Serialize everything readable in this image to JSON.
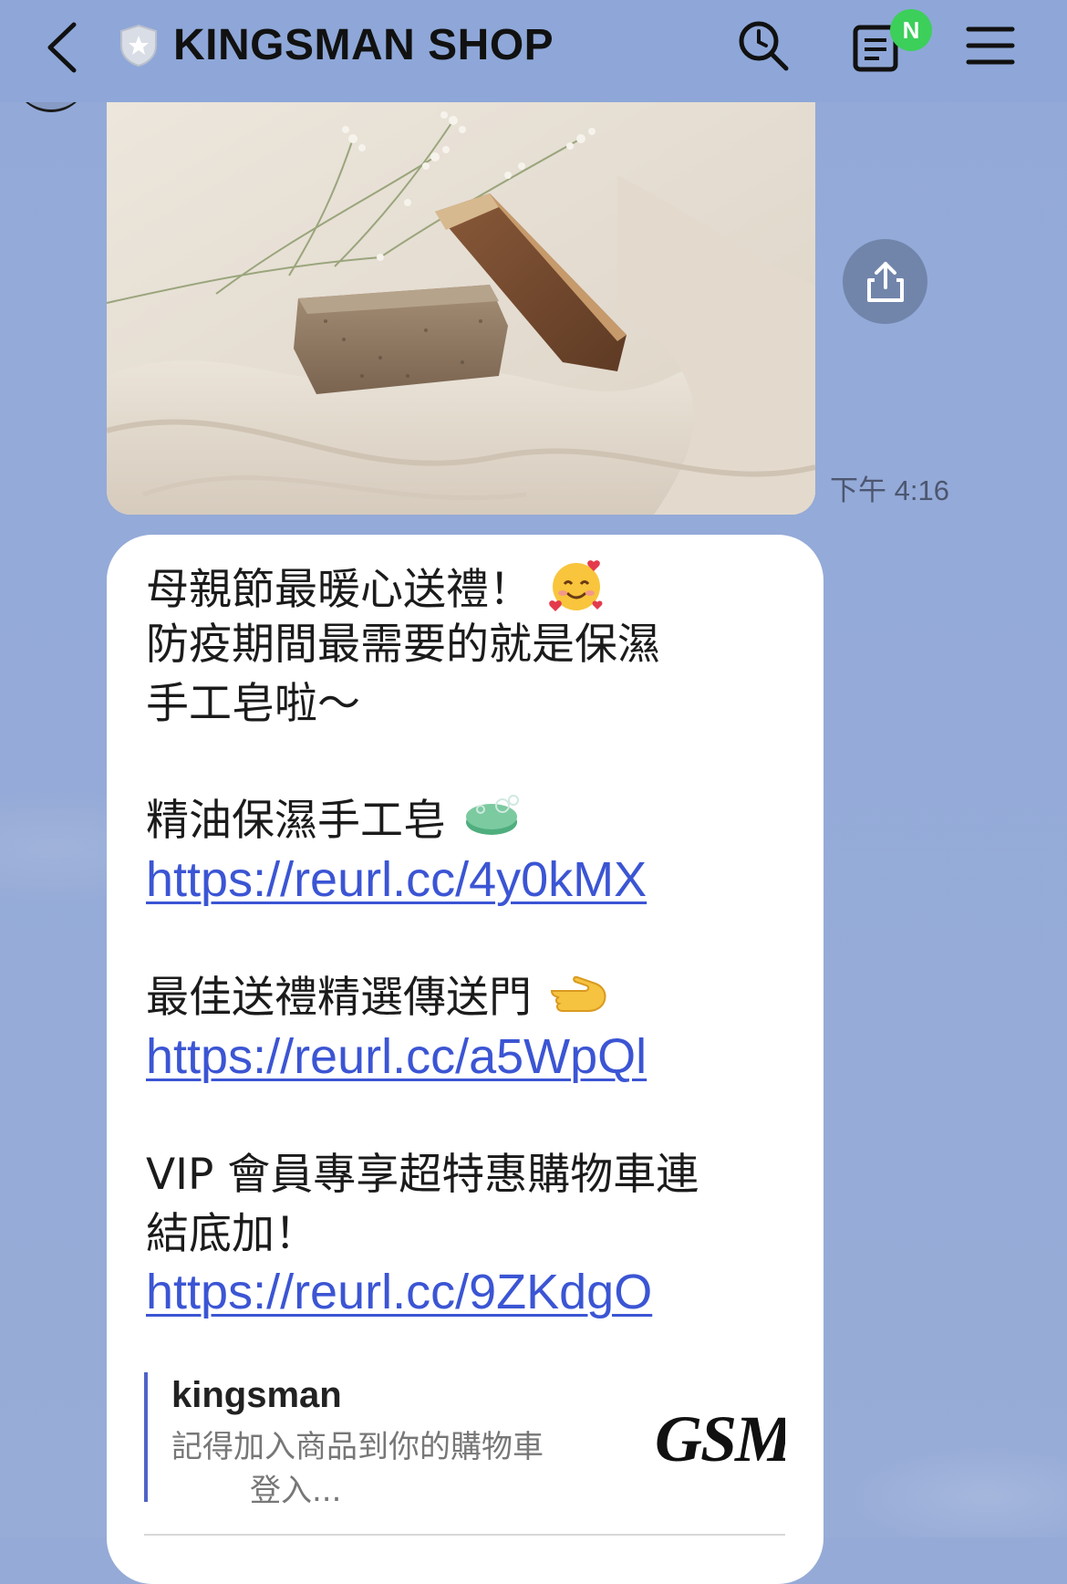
{
  "header": {
    "title": "KINGSMAN SHOP",
    "badge": "N",
    "icons": [
      "back-arrow-icon",
      "shield-star-icon",
      "search-clock-icon",
      "notes-icon",
      "menu-icon"
    ]
  },
  "photo_message": {
    "timestamp": "下午 4:16",
    "share_icon": "share-icon"
  },
  "text_message": {
    "line1": "母親節最暖心送禮！",
    "line2": "防疫期間最需要的就是保濕",
    "line3": "手工皂啦～",
    "product_label": "精油保濕手工皂",
    "product_link": "https://reurl.cc/4y0kMX",
    "gift_label": "最佳送禮精選傳送門",
    "gift_link": "https://reurl.cc/a5WpQl",
    "vip_line1": "VIP 會員專享超特惠購物車連",
    "vip_line2": "結底加！",
    "vip_link": "https://reurl.cc/9ZKdgO"
  },
  "link_preview": {
    "site": "kingsman",
    "desc_line1": "記得加入商品到你的購物車",
    "desc_line2": "登入...",
    "thumb_text": "GSM"
  },
  "colors": {
    "background": "#95aad6",
    "link": "#3b55d4",
    "badge": "#3ccf5a"
  }
}
